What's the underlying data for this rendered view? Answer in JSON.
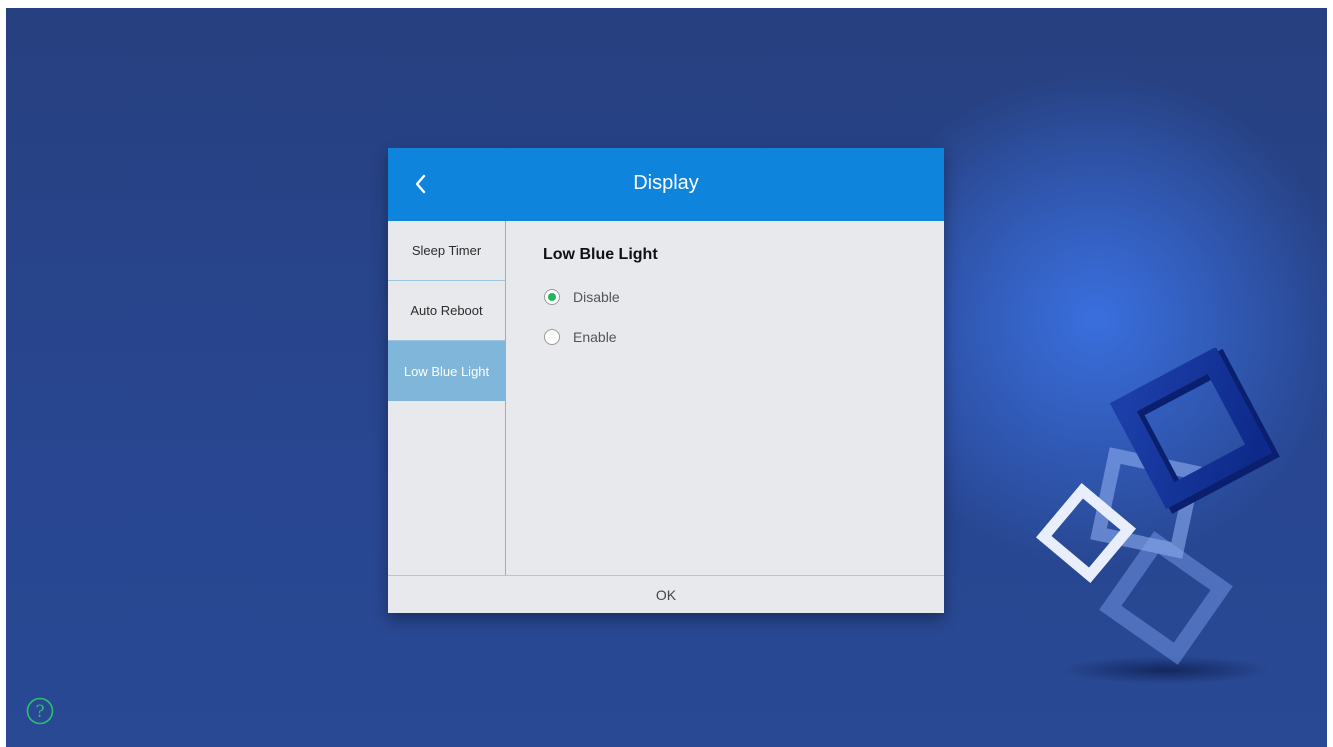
{
  "dialog": {
    "title": "Display",
    "back_icon": "chevron-left-icon",
    "ok_label": "OK"
  },
  "sidebar": {
    "items": [
      {
        "label": "Sleep Timer",
        "active": false
      },
      {
        "label": "Auto Reboot",
        "active": false
      },
      {
        "label": "Low Blue Light",
        "active": true
      }
    ]
  },
  "content": {
    "title": "Low Blue Light",
    "options": [
      {
        "label": "Disable",
        "checked": true
      },
      {
        "label": "Enable",
        "checked": false
      }
    ]
  },
  "help": {
    "icon": "question-circle-icon",
    "glyph": "?"
  },
  "colors": {
    "header": "#0f84dc",
    "active_item": "#7fb6d9",
    "radio_selected": "#20b85c",
    "desktop": "#284691"
  }
}
